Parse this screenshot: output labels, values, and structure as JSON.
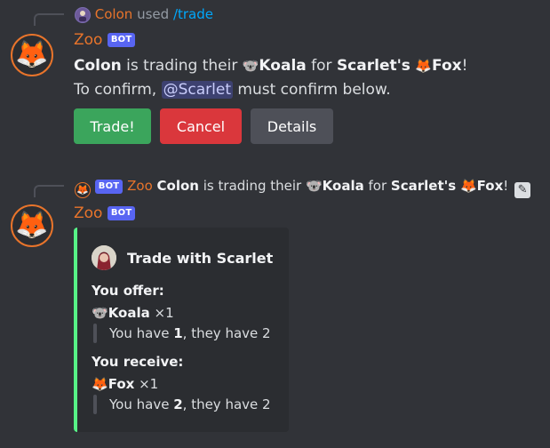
{
  "msg1": {
    "reply": {
      "user": "Colon",
      "used": "used",
      "command": "/trade"
    },
    "author": "Zoo",
    "bot_tag": "BOT",
    "line1": {
      "user": "Colon",
      "mid": "is trading their",
      "item": "Koala",
      "for": "for",
      "target": "Scarlet's",
      "target_item": "Fox",
      "end": "!"
    },
    "line2": {
      "pre": "To confirm,",
      "mention": "@Scarlet",
      "post": "must confirm below."
    },
    "buttons": {
      "trade": "Trade!",
      "cancel": "Cancel",
      "details": "Details"
    }
  },
  "msg2": {
    "reply": {
      "bot_tag": "BOT",
      "author": "Zoo",
      "user": "Colon",
      "mid": "is trading their",
      "item": "Koala",
      "for": "for",
      "target": "Scarlet's",
      "target_item": "Fox",
      "end": "!"
    },
    "author": "Zoo",
    "bot_tag": "BOT",
    "embed": {
      "title": "Trade with Scarlet",
      "offer_heading": "You offer:",
      "offer_item": "Koala",
      "offer_qty": "×1",
      "offer_have_pre": "You have",
      "offer_have_num": "1",
      "offer_have_post": ", they have 2",
      "receive_heading": "You receive:",
      "receive_item": "Fox",
      "receive_qty": "×1",
      "receive_have_pre": "You have",
      "receive_have_num": "2",
      "receive_have_post": ", they have 2"
    }
  },
  "icons": {
    "fox": "🦊",
    "koala": "🐨",
    "edit": "✎"
  },
  "colors": {
    "accent_orange": "#e8742b",
    "bot_blurple": "#5865f2",
    "green": "#3ba55c",
    "red": "#da373c",
    "gray": "#4e5058",
    "embed_bar": "#57f287"
  }
}
